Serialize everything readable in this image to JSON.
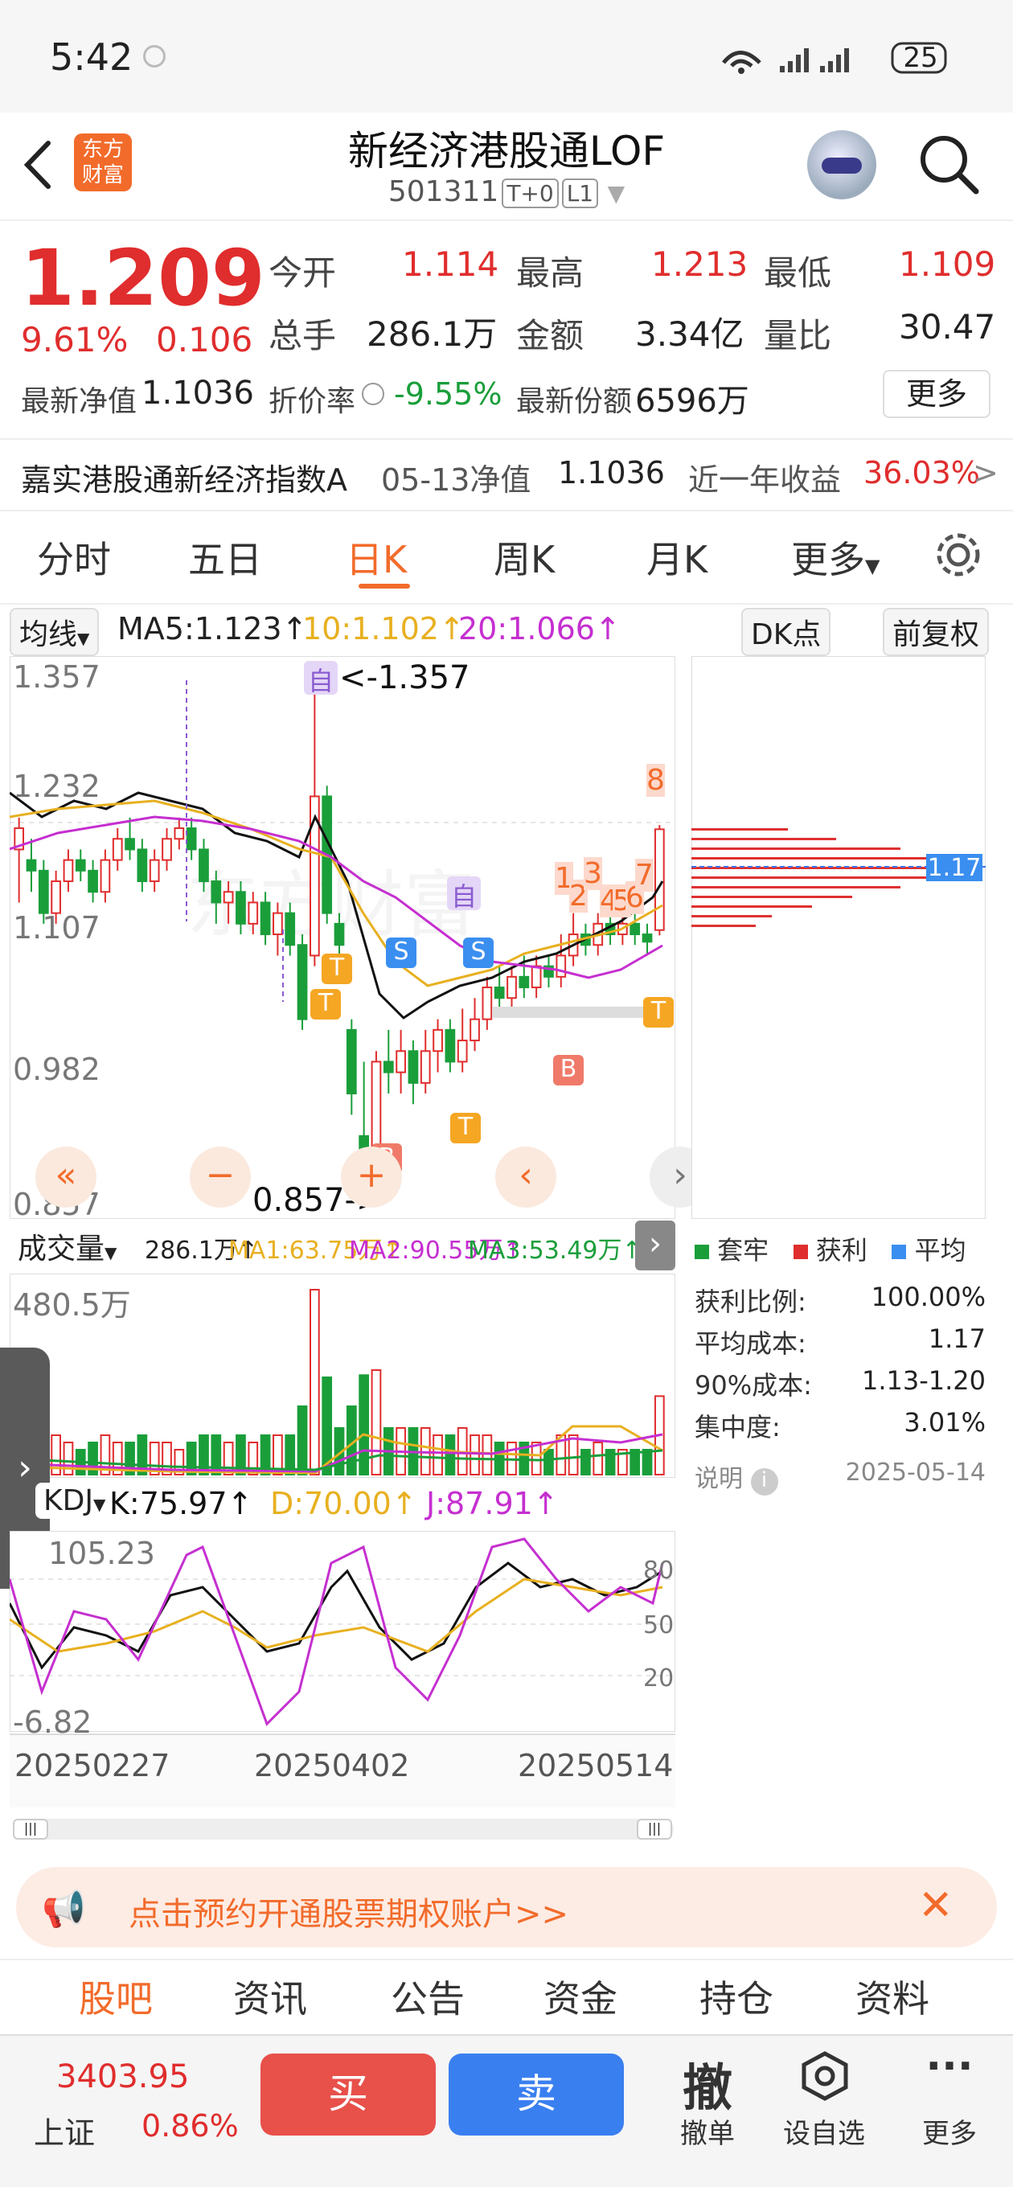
{
  "status": {
    "time": "5:42",
    "battery": "25"
  },
  "header": {
    "title": "新经济港股通LOF",
    "code": "501311",
    "tag1": "T+0",
    "tag2": "L1",
    "logo_line1": "东方",
    "logo_line2": "财富"
  },
  "quote": {
    "price": "1.209",
    "change_pct": "9.61%",
    "change": "0.106",
    "open_label": "今开",
    "open": "1.114",
    "high_label": "最高",
    "high": "1.213",
    "low_label": "最低",
    "low": "1.109",
    "vol_label": "总手",
    "vol": "286.1万",
    "amt_label": "金额",
    "amt": "3.34亿",
    "ratio_label": "量比",
    "ratio": "30.47",
    "nav_label": "最新净值",
    "nav": "1.1036",
    "disc_label": "折价率",
    "disc": "-9.55%",
    "share_label": "最新份额",
    "share": "6596万",
    "more": "更多"
  },
  "fund": {
    "name": "嘉实港股通新经济指数A",
    "nav_date": "05-13净值",
    "nav": "1.1036",
    "ret_label": "近一年收益",
    "ret": "36.03%"
  },
  "tabs": [
    "分时",
    "五日",
    "日K",
    "周K",
    "月K",
    "更多"
  ],
  "active_tab": 2,
  "ma_bar": {
    "label": "均线",
    "ma5": "MA5:1.123↑",
    "ma10": "10:1.102↑",
    "ma20": "20:1.066↑",
    "dk": "DK点",
    "fq": "前复权"
  },
  "kline": {
    "y_ticks": [
      "1.357",
      "1.232",
      "1.107",
      "0.982",
      "0.857"
    ],
    "high_note": "<-1.357",
    "low_note": "0.857->",
    "marker_self": "自",
    "marker_s": "S",
    "marker_t": "T",
    "marker_b": "B",
    "nums": [
      "1",
      "2",
      "3",
      "4",
      "5",
      "6",
      "7",
      "8"
    ]
  },
  "chip": {
    "cost_label": "1.17",
    "legend": [
      "套牢",
      "获利",
      "平均"
    ],
    "rows": [
      {
        "k": "获利比例:",
        "v": "100.00%"
      },
      {
        "k": "平均成本:",
        "v": "1.17"
      },
      {
        "k": "90%成本:",
        "v": "1.13-1.20"
      },
      {
        "k": "集中度:",
        "v": "3.01%"
      }
    ],
    "explain": "说明",
    "date": "2025-05-14"
  },
  "volume": {
    "label": "成交量",
    "v": "286.1万↑",
    "ma1": "MA1:63.75万↑",
    "ma2": "MA2:90.55万↑",
    "ma3": "MA3:53.49万↑",
    "max": "480.5万"
  },
  "kdj": {
    "label": "KDJ",
    "k": "K:75.97↑",
    "d": "D:70.00↑",
    "j": "J:87.91↑",
    "top": "105.23",
    "bottom": "-6.82",
    "levels": [
      "80",
      "50",
      "20"
    ]
  },
  "dates": [
    "20250227",
    "20250402",
    "20250514"
  ],
  "banner": {
    "text": "点击预约开通股票期权账户>>"
  },
  "bottom_tabs": [
    "股吧",
    "资讯",
    "公告",
    "资金",
    "持仓",
    "资料"
  ],
  "index": {
    "value": "3403.95",
    "name": "上证",
    "pct": "0.86%"
  },
  "actions": {
    "buy": "买",
    "sell": "卖",
    "cancel_big": "撤",
    "cancel": "撤单",
    "watch": "设自选",
    "more": "更多"
  },
  "chart_data": {
    "type": "candlestick",
    "ylim": [
      0.857,
      1.357
    ],
    "x_tick_labels": [
      "20250227",
      "20250402",
      "20250514"
    ],
    "candles": [
      [
        1.19,
        1.21,
        1.22,
        1.14
      ],
      [
        1.18,
        1.17,
        1.2,
        1.15
      ],
      [
        1.17,
        1.13,
        1.18,
        1.12
      ],
      [
        1.13,
        1.16,
        1.17,
        1.12
      ],
      [
        1.16,
        1.18,
        1.19,
        1.15
      ],
      [
        1.18,
        1.17,
        1.19,
        1.16
      ],
      [
        1.17,
        1.15,
        1.18,
        1.14
      ],
      [
        1.15,
        1.18,
        1.19,
        1.14
      ],
      [
        1.18,
        1.2,
        1.21,
        1.17
      ],
      [
        1.2,
        1.19,
        1.22,
        1.18
      ],
      [
        1.19,
        1.16,
        1.2,
        1.15
      ],
      [
        1.16,
        1.18,
        1.19,
        1.15
      ],
      [
        1.18,
        1.2,
        1.21,
        1.17
      ],
      [
        1.2,
        1.21,
        1.22,
        1.19
      ],
      [
        1.21,
        1.19,
        1.22,
        1.18
      ],
      [
        1.19,
        1.16,
        1.2,
        1.15
      ],
      [
        1.16,
        1.14,
        1.17,
        1.12
      ],
      [
        1.14,
        1.15,
        1.16,
        1.12
      ],
      [
        1.15,
        1.12,
        1.16,
        1.11
      ],
      [
        1.12,
        1.14,
        1.15,
        1.11
      ],
      [
        1.14,
        1.11,
        1.15,
        1.1
      ],
      [
        1.11,
        1.13,
        1.14,
        1.09
      ],
      [
        1.13,
        1.1,
        1.14,
        1.09
      ],
      [
        1.1,
        1.03,
        1.11,
        1.02
      ],
      [
        1.09,
        1.24,
        1.357,
        1.08
      ],
      [
        1.24,
        1.13,
        1.25,
        1.12
      ],
      [
        1.12,
        1.1,
        1.13,
        1.07
      ],
      [
        1.02,
        0.96,
        1.03,
        0.94
      ],
      [
        0.92,
        0.87,
        0.99,
        0.857
      ],
      [
        0.88,
        0.99,
        1.0,
        0.86
      ],
      [
        0.99,
        0.98,
        1.02,
        0.96
      ],
      [
        0.98,
        1.0,
        1.02,
        0.96
      ],
      [
        1.0,
        0.97,
        1.01,
        0.95
      ],
      [
        0.97,
        1.0,
        1.02,
        0.96
      ],
      [
        1.0,
        1.02,
        1.03,
        0.98
      ],
      [
        1.02,
        0.99,
        1.03,
        0.98
      ],
      [
        0.99,
        1.01,
        1.04,
        0.98
      ],
      [
        1.01,
        1.03,
        1.05,
        1.0
      ],
      [
        1.03,
        1.06,
        1.07,
        1.02
      ],
      [
        1.06,
        1.05,
        1.08,
        1.04
      ],
      [
        1.05,
        1.07,
        1.08,
        1.04
      ],
      [
        1.07,
        1.06,
        1.09,
        1.05
      ],
      [
        1.06,
        1.08,
        1.09,
        1.05
      ],
      [
        1.08,
        1.07,
        1.09,
        1.06
      ],
      [
        1.07,
        1.09,
        1.11,
        1.06
      ],
      [
        1.09,
        1.11,
        1.13,
        1.08
      ],
      [
        1.11,
        1.1,
        1.12,
        1.09
      ],
      [
        1.1,
        1.12,
        1.13,
        1.09
      ],
      [
        1.12,
        1.11,
        1.13,
        1.1
      ],
      [
        1.11,
        1.12,
        1.13,
        1.1
      ],
      [
        1.12,
        1.11,
        1.13,
        1.1
      ],
      [
        1.11,
        1.103,
        1.12,
        1.09
      ],
      [
        1.114,
        1.209,
        1.213,
        1.109
      ]
    ]
  }
}
